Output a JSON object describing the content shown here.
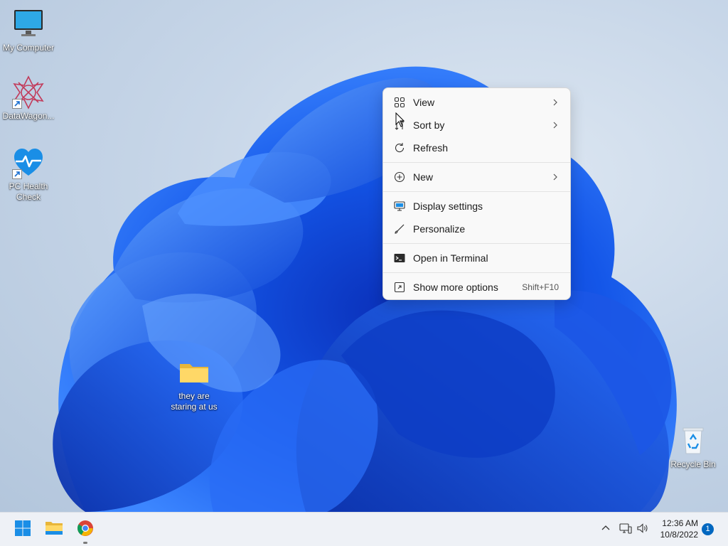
{
  "desktop": {
    "icons": [
      {
        "label": "My Computer"
      },
      {
        "label": "DataWagon..."
      },
      {
        "label": "PC Health Check"
      },
      {
        "label": "they are staring at us"
      },
      {
        "label": "Recycle Bin"
      }
    ]
  },
  "context_menu": {
    "items": [
      {
        "label": "View",
        "icon": "grid-icon",
        "has_submenu": true
      },
      {
        "label": "Sort by",
        "icon": "sort-icon",
        "has_submenu": true
      },
      {
        "label": "Refresh",
        "icon": "refresh-icon"
      },
      {
        "label": "New",
        "icon": "plus-circle-icon",
        "has_submenu": true
      },
      {
        "label": "Display settings",
        "icon": "display-icon"
      },
      {
        "label": "Personalize",
        "icon": "brush-icon"
      },
      {
        "label": "Open in Terminal",
        "icon": "terminal-icon"
      },
      {
        "label": "Show more options",
        "icon": "more-options-icon",
        "shortcut": "Shift+F10"
      }
    ]
  },
  "taskbar": {
    "apps": [
      {
        "name": "Start",
        "icon": "windows-start-icon"
      },
      {
        "name": "File Explorer",
        "icon": "folder-icon"
      },
      {
        "name": "Google Chrome",
        "icon": "chrome-icon"
      }
    ],
    "clock": {
      "time": "12:36 AM",
      "date": "10/8/2022"
    },
    "notification_count": "1"
  },
  "colors": {
    "accent": "#0067c0",
    "wallpaper_blue": "#1a5cf0",
    "menu_bg": "#f9f9f9",
    "taskbar_bg": "#eef1f6"
  }
}
